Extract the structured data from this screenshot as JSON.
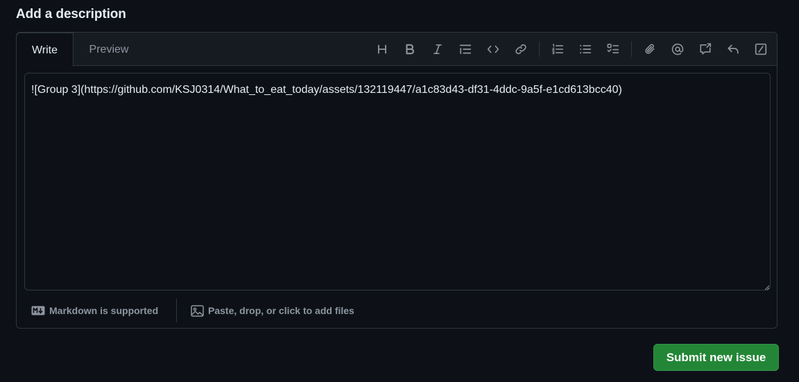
{
  "section": {
    "title": "Add a description"
  },
  "tabs": {
    "write": "Write",
    "preview": "Preview"
  },
  "toolbar": {
    "icons": [
      "heading-icon",
      "bold-icon",
      "italic-icon",
      "quote-icon",
      "code-icon",
      "link-icon",
      "ordered-list-icon",
      "unordered-list-icon",
      "task-list-icon",
      "attach-icon",
      "mention-icon",
      "reference-icon",
      "reply-icon",
      "slash-command-icon"
    ]
  },
  "editor": {
    "value": "![Group 3](https://github.com/KSJ0314/What_to_eat_today/assets/132119447/a1c83d43-df31-4ddc-9a5f-e1cd613bcc40)"
  },
  "footer": {
    "markdown": "Markdown is supported",
    "files": "Paste, drop, or click to add files"
  },
  "submit": {
    "label": "Submit new issue"
  },
  "colors": {
    "background": "#0d1117",
    "header": "#161b22",
    "border": "#30363d",
    "muted": "#8d96a0",
    "primary_button": "#238636"
  }
}
